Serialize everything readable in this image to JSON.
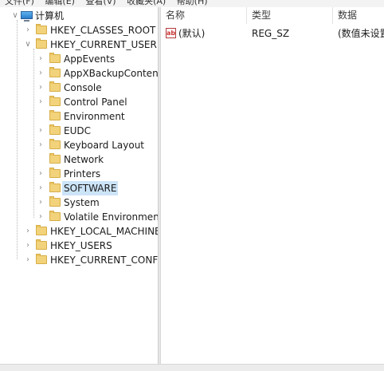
{
  "menu": [
    "文件(F)",
    "编辑(E)",
    "查看(V)",
    "收藏夹(A)",
    "帮助(H)"
  ],
  "tree": {
    "root": "计算机",
    "hives": {
      "classes_root": "HKEY_CLASSES_ROOT",
      "current_user": "HKEY_CURRENT_USER",
      "local_machine": "HKEY_LOCAL_MACHINE",
      "users": "HKEY_USERS",
      "current_config": "HKEY_CURRENT_CONFIG"
    },
    "current_user_children": [
      "AppEvents",
      "AppXBackupContentTy",
      "Console",
      "Control Panel",
      "Environment",
      "EUDC",
      "Keyboard Layout",
      "Network",
      "Printers",
      "SOFTWARE",
      "System",
      "Volatile Environment"
    ],
    "selected": "SOFTWARE"
  },
  "list": {
    "columns": [
      "名称",
      "类型",
      "数据"
    ],
    "rows": [
      {
        "name": "(默认)",
        "type": "REG_SZ",
        "data": "(数值未设置"
      }
    ],
    "value_icon_text": "ab"
  },
  "icons": {
    "expand_collapsed": "chevron-right-icon",
    "expand_open": "chevron-down-icon",
    "folder": "folder-icon",
    "computer": "computer-icon",
    "string_value": "string-value-icon"
  },
  "colors": {
    "folder": "#f2d37b",
    "selection": "#cce4f7"
  }
}
